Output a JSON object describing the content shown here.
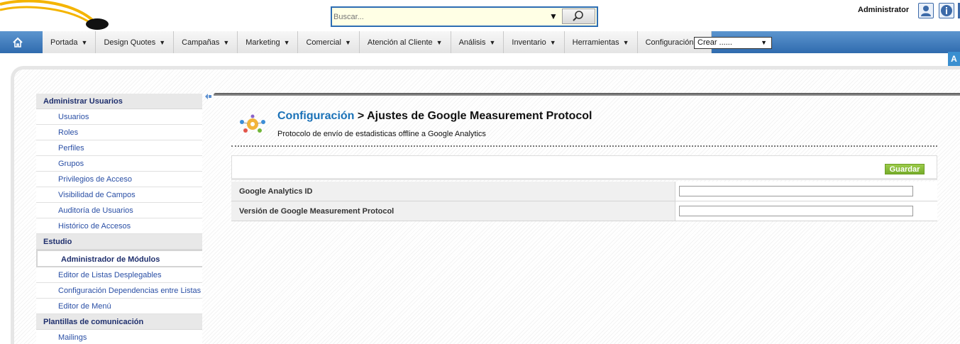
{
  "header": {
    "search": {
      "placeholder": "Buscar..."
    },
    "user_name": "Administrator"
  },
  "menu": {
    "tabs": [
      {
        "label": "Portada",
        "arrow": "▼"
      },
      {
        "label": "Design Quotes",
        "arrow": "▼"
      },
      {
        "label": "Campañas",
        "arrow": "▼"
      },
      {
        "label": "Marketing",
        "arrow": "▼"
      },
      {
        "label": "Comercial",
        "arrow": "▼"
      },
      {
        "label": "Atención al Cliente",
        "arrow": "▼"
      },
      {
        "label": "Análisis",
        "arrow": "▼"
      },
      {
        "label": "Inventario",
        "arrow": "▼"
      },
      {
        "label": "Herramientas",
        "arrow": "▼"
      },
      {
        "label": "Configuración",
        "arrow": "▼"
      }
    ],
    "create_select": "Crear ......",
    "corner_badge": "A"
  },
  "sidebar": {
    "sections": [
      {
        "title": "Administrar Usuarios",
        "items": [
          "Usuarios",
          "Roles",
          "Perfiles",
          "Grupos",
          "Privilegios de Acceso",
          "Visibilidad de Campos",
          "Auditoría de Usuarios",
          "Histórico de Accesos"
        ]
      },
      {
        "title": "Estudio",
        "items": [
          "Administrador de Módulos",
          "Editor de Listas Desplegables",
          "Configuración Dependencias entre Listas",
          "Editor de Menú"
        ]
      },
      {
        "title": "Plantillas de comunicación",
        "items": [
          "Mailings"
        ]
      }
    ],
    "active_item": "Administrador de Módulos"
  },
  "page": {
    "breadcrumb": "Configuración",
    "separator": ">",
    "title": "Ajustes de Google Measurement Protocol",
    "subtitle": "Protocolo de envío de estadisticas offline a Google Analytics",
    "save_label": "Guardar",
    "fields": [
      {
        "label": "Google Analytics ID",
        "value": ""
      },
      {
        "label": "Versión de Google Measurement Protocol",
        "value": ""
      }
    ]
  },
  "colors": {
    "menu_blue": "#2f6bae",
    "link_blue": "#2a4fa5",
    "title_blue": "#1b72b8",
    "save_green": "#76ad2a"
  }
}
